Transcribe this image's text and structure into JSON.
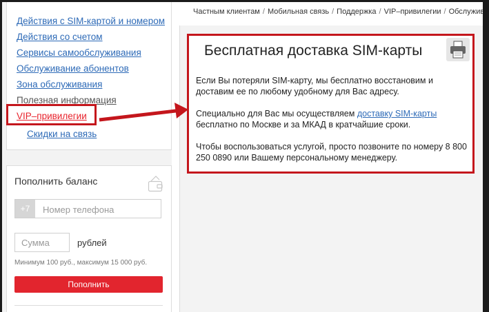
{
  "breadcrumb": [
    {
      "label": "Частным клиентам"
    },
    {
      "label": "Мобильная связь"
    },
    {
      "label": "Поддержка"
    },
    {
      "label": "VIP–привилегии"
    },
    {
      "label": "Обслужива"
    }
  ],
  "breadcrumb_separator": "/",
  "sidebar": {
    "items": [
      {
        "label": "Действия с SIM-картой и номером"
      },
      {
        "label": "Действия со счетом"
      },
      {
        "label": "Сервисы самообслуживания"
      },
      {
        "label": "Обслуживание абонентов"
      },
      {
        "label": "Зона обслуживания"
      },
      {
        "label": "Полезная информация"
      },
      {
        "label": "VIP–привилегии",
        "state": "active"
      },
      {
        "label": "Скидки на связь",
        "level": "sub"
      }
    ]
  },
  "balance": {
    "title": "Пополнить баланс",
    "phone_prefix": "+7",
    "phone_placeholder": "Номер телефона",
    "sum_placeholder": "Сумма",
    "currency_label": "рублей",
    "limits_text": "Минимум 100 руб., максимум 15 000 руб.",
    "button_label": "Пополнить",
    "icon": "wallet-icon"
  },
  "content": {
    "title": "Бесплатная доставка SIM-карты",
    "print_icon": "printer-icon",
    "paragraph1": "Если Вы потеряли SIM-карту, мы бесплатно восстановим и доставим ее по любому удобному для Вас адресу.",
    "paragraph2_before": "Специально для Вас мы осуществляем ",
    "paragraph2_link": "доставку SIM-карты",
    "paragraph2_after": " бесплатно по Москве и за МКАД в кратчайшие сроки.",
    "paragraph3": "Чтобы воспользоваться услугой, просто позвоните по номеру 8 800 250 0890 или Вашему персональному менеджеру."
  },
  "colors": {
    "link": "#2d6ab7",
    "highlight": "#c4161c",
    "brand_red": "#e2252e"
  }
}
